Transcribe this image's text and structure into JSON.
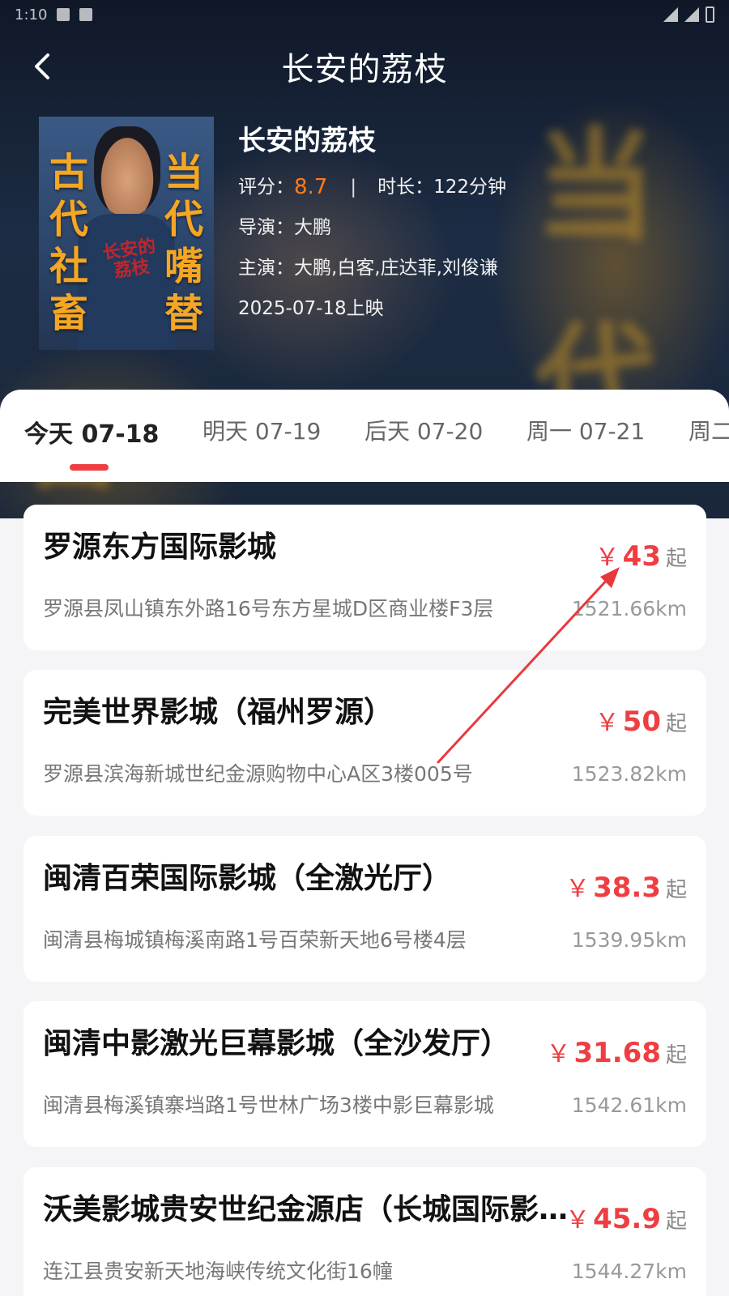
{
  "status_bar": {
    "time": "1:10"
  },
  "nav": {
    "title": "长安的荔枝"
  },
  "movie": {
    "poster_left": "古代社畜",
    "poster_right": "当代嘴替",
    "poster_logo": "长安的荔枝",
    "name": "长安的荔枝",
    "score_label": "评分：",
    "score": "8.7",
    "separator": "|",
    "duration": "时长：122分钟",
    "director": "导演：大鹏",
    "cast": "主演：大鹏,白客,庄达菲,刘俊谦",
    "release": "2025-07-18上映"
  },
  "date_tabs": [
    {
      "label": "今天 07-18",
      "active": true
    },
    {
      "label": "明天 07-19",
      "active": false
    },
    {
      "label": "后天 07-20",
      "active": false
    },
    {
      "label": "周一 07-21",
      "active": false
    },
    {
      "label": "周二",
      "active": false
    }
  ],
  "price_symbol": "￥",
  "price_suffix": "起",
  "cinemas": [
    {
      "name": "罗源东方国际影城",
      "price": "43",
      "address": "罗源县凤山镇东外路16号东方星城D区商业楼F3层",
      "distance": "1521.66km"
    },
    {
      "name": "完美世界影城（福州罗源）",
      "price": "50",
      "address": "罗源县滨海新城世纪金源购物中心A区3楼005号",
      "distance": "1523.82km"
    },
    {
      "name": "闽清百荣国际影城（全激光厅）",
      "price": "38.3",
      "address": "闽清县梅城镇梅溪南路1号百荣新天地6号楼4层",
      "distance": "1539.95km"
    },
    {
      "name": "闽清中影激光巨幕影城（全沙发厅）",
      "price": "31.68",
      "address": "闽清县梅溪镇寨垱路1号世林广场3楼中影巨幕影城",
      "distance": "1542.61km"
    },
    {
      "name": "沃美影城贵安世纪金源店（长城国际影城）",
      "price": "45.9",
      "address": "连江县贵安新天地海峡传统文化街16幢",
      "distance": "1544.27km"
    }
  ],
  "colors": {
    "accent": "#ef3e42",
    "score": "#ff7a1a",
    "poster_text": "#f5a623"
  }
}
